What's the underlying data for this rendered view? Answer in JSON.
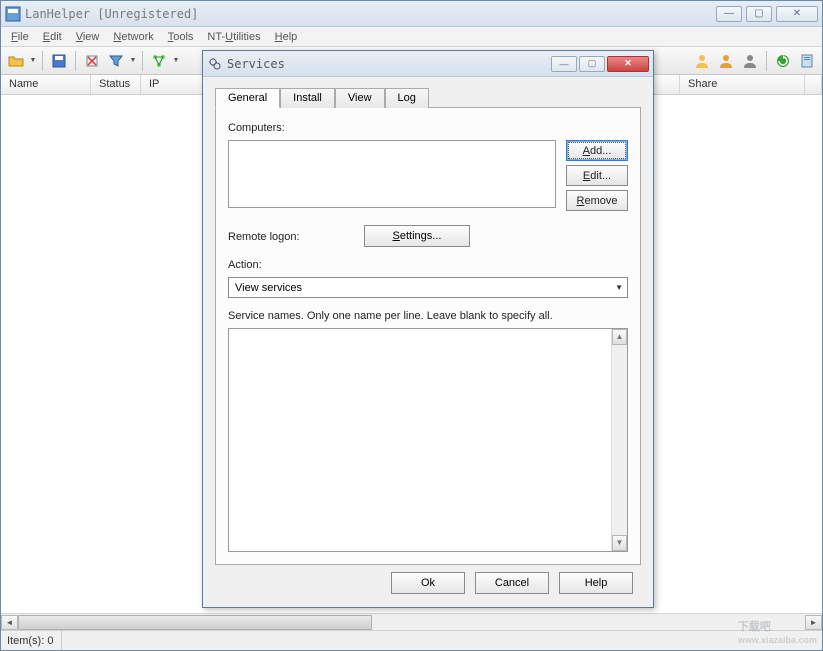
{
  "main": {
    "title": "LanHelper [Unregistered]",
    "menu": {
      "file": "File",
      "edit": "Edit",
      "view": "View",
      "network": "Network",
      "tools": "Tools",
      "nt": "NT-Utilities",
      "help": "Help"
    },
    "columns": {
      "name": "Name",
      "status": "Status",
      "ip": "IP",
      "share": "Share"
    },
    "status_items": "Item(s): 0"
  },
  "dialog": {
    "title": "Services",
    "tabs": {
      "general": "General",
      "install": "Install",
      "view": "View",
      "log": "Log"
    },
    "labels": {
      "computers": "Computers:",
      "remote_logon": "Remote logon:",
      "action": "Action:",
      "service_hint": "Service names. Only one name per line. Leave blank to specify all."
    },
    "buttons": {
      "add": "Add...",
      "edit": "Edit...",
      "remove": "Remove",
      "settings": "Settings...",
      "ok": "Ok",
      "cancel": "Cancel",
      "help": "Help"
    },
    "action_value": "View services"
  },
  "watermark": {
    "big": "下载吧",
    "small": "www.xiazaiba.com"
  }
}
